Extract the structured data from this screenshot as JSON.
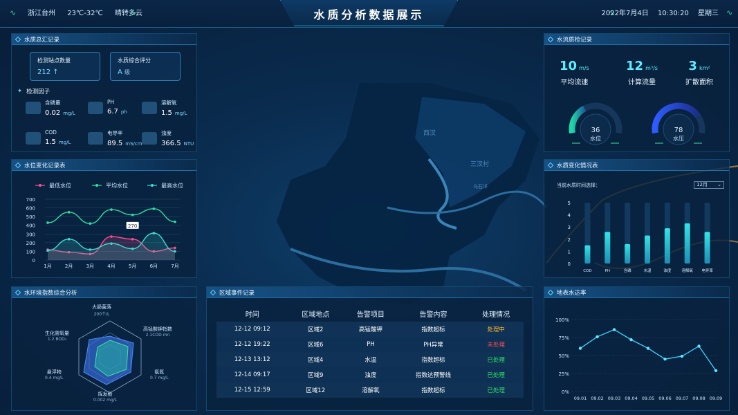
{
  "header": {
    "title": "水质分析数据展示",
    "location": "浙江台州",
    "temperature": "23℃-32℃",
    "weather": "晴转多云",
    "date": "2022年7月4日",
    "time": "10:30:20",
    "weekday": "星期三"
  },
  "summary": {
    "title": "水质总汇记录",
    "stations_label": "检测站点数量",
    "stations_value": "212",
    "stations_arrow": "↑",
    "score_label": "水质综合评分",
    "score_value": "A",
    "score_unit": "级",
    "factors_title": "检测因子",
    "factors": [
      {
        "name": "含磷量",
        "value": "0.02",
        "unit": "mg/L"
      },
      {
        "name": "PH",
        "value": "6.7",
        "unit": "ph"
      },
      {
        "name": "溶解氧",
        "value": "1.5",
        "unit": "mg/L"
      },
      {
        "name": "COD",
        "value": "1.5",
        "unit": "mg/L"
      },
      {
        "name": "电导率",
        "value": "89.5",
        "unit": "mS/cm"
      },
      {
        "name": "浊度",
        "value": "366.5",
        "unit": "NTU"
      }
    ]
  },
  "water_level": {
    "title": "水位变化记录表",
    "tooltip": "270",
    "legend": [
      "最低水位",
      "平均水位",
      "最高水位"
    ]
  },
  "env_index": {
    "title": "水环境指数综合分析",
    "indicators": [
      {
        "name": "大肠菌落",
        "value": "200个/L"
      },
      {
        "name": "高锰酸钾指数",
        "value": "2.1COD",
        "unit": "mn"
      },
      {
        "name": "氨氮",
        "value": "0.7",
        "unit": "mg/L"
      },
      {
        "name": "挥发酚",
        "value": "0.002",
        "unit": "mg/L"
      },
      {
        "name": "悬浮物",
        "value": "0.4",
        "unit": "mg/L"
      },
      {
        "name": "生化需氧量",
        "value": "1.2",
        "unit": "BOD₅"
      }
    ]
  },
  "events": {
    "title": "区域事件记录",
    "columns": [
      "时间",
      "区域地点",
      "告警项目",
      "告警内容",
      "处理情况"
    ],
    "rows": [
      [
        "12-12 09:12",
        "区域2",
        "高锰酸钾",
        "指数超标",
        "处理中"
      ],
      [
        "12-12 19:22",
        "区域6",
        "PH",
        "PH异常",
        "未处理"
      ],
      [
        "12-13 13:12",
        "区域4",
        "水温",
        "指数超标",
        "已处理"
      ],
      [
        "12-14 09:17",
        "区域9",
        "浊度",
        "指数达预警线",
        "已处理"
      ],
      [
        "12-15 12:59",
        "区域12",
        "溶解氧",
        "指数超标",
        "已处理"
      ]
    ],
    "status_colors": {
      "处理中": "#ffb52e",
      "未处理": "#ff4d4f",
      "已处理": "#2fe06a"
    }
  },
  "flow": {
    "title": "水流质检记录",
    "metrics": [
      {
        "value": "10",
        "unit": "m/s",
        "label": "平均流速"
      },
      {
        "value": "12",
        "unit": "m³/s",
        "label": "计算流量"
      },
      {
        "value": "3",
        "unit": "km²",
        "label": "扩散面积"
      }
    ],
    "gauges": [
      {
        "value": "36",
        "label": "水位",
        "fraction": 0.36
      },
      {
        "value": "78",
        "label": "水压",
        "fraction": 0.78
      }
    ]
  },
  "quality_change": {
    "title": "水质变化情况表",
    "select_label": "当前水质时间选择：",
    "select_value": "12月"
  },
  "surface": {
    "title": "地表水达率"
  },
  "map_labels": [
    "西汊",
    "三汊村",
    "乌石洋"
  ],
  "chart_data": [
    {
      "type": "line",
      "x": [
        "1月",
        "2月",
        "3月",
        "4月",
        "5月",
        "6月",
        "7月"
      ],
      "ylim": [
        0,
        700
      ],
      "yticks": [
        0,
        100,
        200,
        300,
        400,
        500,
        600,
        700
      ],
      "series": [
        {
          "name": "最低水位",
          "values": [
            120,
            90,
            70,
            270,
            240,
            100,
            140
          ],
          "color": "#ff4f8f"
        },
        {
          "name": "平均水位",
          "values": [
            430,
            550,
            420,
            580,
            520,
            590,
            440
          ],
          "color": "#2fe0a0"
        },
        {
          "name": "最高水位",
          "values": [
            110,
            240,
            120,
            190,
            130,
            310,
            100
          ],
          "color": "#3fdcd0"
        }
      ]
    },
    {
      "type": "bar",
      "categories": [
        "COD",
        "PH",
        "含磷",
        "水温",
        "浊度",
        "溶解氧",
        "电导率"
      ],
      "values": [
        1.5,
        2.6,
        1.6,
        2.3,
        2.9,
        3.3,
        2.6
      ],
      "ylim": [
        0,
        5
      ],
      "yticks": [
        0,
        1,
        2,
        3,
        4,
        5
      ]
    },
    {
      "type": "line",
      "x": [
        "09.01",
        "09.02",
        "09.03",
        "09.04",
        "09.05",
        "09.06",
        "09.07",
        "09.08",
        "09.09"
      ],
      "ylim": [
        0,
        100
      ],
      "yticks": [
        "0%",
        "25%",
        "50%",
        "75%",
        "100%"
      ],
      "values": [
        60,
        76,
        86,
        72,
        60,
        45,
        49,
        63,
        29
      ]
    }
  ]
}
